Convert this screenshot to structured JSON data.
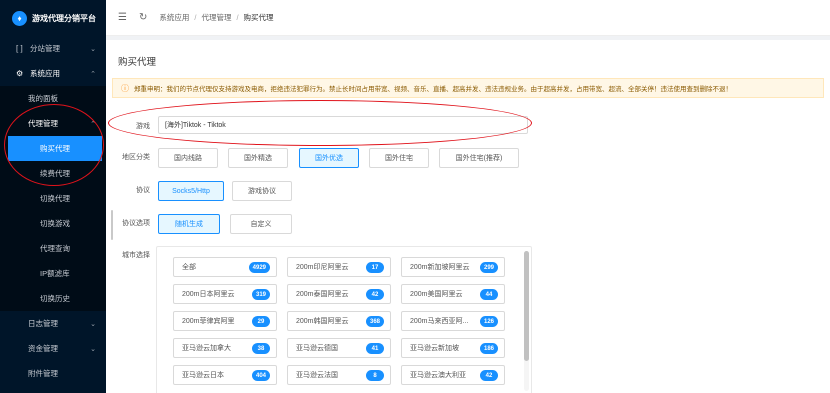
{
  "brand": {
    "title": "游戏代理分销平台"
  },
  "sidebar": {
    "items": [
      {
        "label": "分站管理",
        "icon": "bracket-icon",
        "chevron": "⌄"
      },
      {
        "label": "系统应用",
        "icon": "gear-icon",
        "chevron": "⌃"
      },
      {
        "label": "我的面板"
      },
      {
        "label": "代理管理",
        "chevron": "⌃"
      },
      {
        "label": "购买代理"
      },
      {
        "label": "续费代理"
      },
      {
        "label": "切换代理"
      },
      {
        "label": "切换游戏"
      },
      {
        "label": "代理查询"
      },
      {
        "label": "IP额滤库"
      },
      {
        "label": "切换历史"
      },
      {
        "label": "日志管理",
        "chevron": "⌄"
      },
      {
        "label": "资金管理",
        "chevron": "⌄"
      },
      {
        "label": "附件管理"
      }
    ]
  },
  "header": {
    "breadcrumb": [
      "系统应用",
      "代理管理",
      "购买代理"
    ]
  },
  "main": {
    "page_title": "购买代理",
    "notice": "郑重申明：我们的节点代理仅支持游戏及电商，拒绝违法犯罪行为。禁止长时间占用带宽、视频、音乐、直播、超高并发、违法违规业务。由于超高并发，占用带宽、超流、全部关停！违法使用查到删除不退！",
    "game_label": "游戏",
    "game_value": "[海外]Tiktok - Tiktok",
    "region_label": "地区分类",
    "regions": [
      "国内线路",
      "国外精选",
      "国外优选",
      "国外住宅",
      "国外住宅(推荐)"
    ],
    "region_selected": "国外优选",
    "protocol_label": "协议",
    "protocols": [
      "Socks5/Http",
      "游戏协议"
    ],
    "protocol_selected": "Socks5/Http",
    "protocol_option_label": "协议选项",
    "protocol_options": [
      "随机生成",
      "自定义"
    ],
    "protocol_option_selected": "随机生成",
    "city_label": "城市选择",
    "cities": [
      {
        "name": "全部",
        "count": "4929"
      },
      {
        "name": "200m印尼阿里云",
        "count": "17"
      },
      {
        "name": "200m新加坡阿里云",
        "count": "299"
      },
      {
        "name": "200m日本阿里云",
        "count": "319"
      },
      {
        "name": "200m泰国阿里云",
        "count": "42"
      },
      {
        "name": "200m美国阿里云",
        "count": "44"
      },
      {
        "name": "200m菲律宾阿里",
        "count": "29"
      },
      {
        "name": "200m韩国阿里云",
        "count": "368"
      },
      {
        "name": "200m马来西亚阿...",
        "count": "126"
      },
      {
        "name": "亚马逊云加拿大",
        "count": "38"
      },
      {
        "name": "亚马逊云德国",
        "count": "41"
      },
      {
        "name": "亚马逊云新加坡",
        "count": "186"
      },
      {
        "name": "亚马逊云日本",
        "count": "404"
      },
      {
        "name": "亚马逊云法国",
        "count": "8"
      },
      {
        "name": "亚马逊云澳大利亚",
        "count": "42"
      }
    ]
  },
  "colors": {
    "accent": "#1890ff",
    "sidebar_bg": "#001529",
    "annotation": "#e0131b"
  }
}
